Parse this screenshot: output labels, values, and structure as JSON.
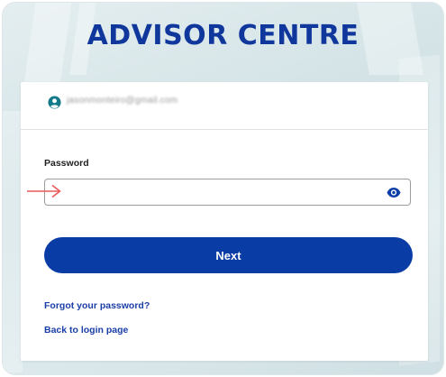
{
  "brand": {
    "title": "ADVISOR CENTRE"
  },
  "user": {
    "email": "jasonmonteiro@gmail.com",
    "icon": "user-circle-icon"
  },
  "form": {
    "password_label": "Password",
    "password_value": "",
    "next_label": "Next",
    "forgot_link": "Forgot your password?",
    "back_link": "Back to login page"
  },
  "colors": {
    "brand": "#10379c",
    "button": "#0a3ca6",
    "link": "#1a3ea8",
    "arrow": "#e8595a"
  }
}
